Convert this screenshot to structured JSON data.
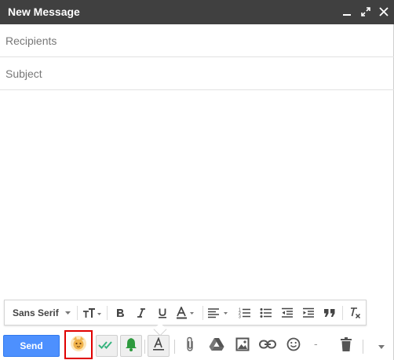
{
  "window": {
    "title": "New Message",
    "controls": [
      "minimize-icon",
      "expand-icon",
      "close-icon"
    ]
  },
  "fields": {
    "recipients_placeholder": "Recipients",
    "recipients_value": "",
    "subject_placeholder": "Subject",
    "subject_value": ""
  },
  "body": {
    "text": ""
  },
  "format_toolbar": {
    "font_family": "Sans Serif",
    "items": [
      "font-size-icon",
      "bold-icon",
      "italic-icon",
      "underline-icon",
      "text-color-icon",
      "align-icon",
      "numbered-list-icon",
      "bulleted-list-icon",
      "indent-less-icon",
      "indent-more-icon",
      "quote-icon",
      "remove-formatting-icon"
    ]
  },
  "action_bar": {
    "send_label": "Send",
    "dash_label": "-",
    "items": [
      "extension-avatar-icon",
      "double-check-icon",
      "bell-icon",
      "formatting-toggle-icon",
      "attach-icon",
      "drive-icon",
      "insert-photo-icon",
      "link-icon",
      "emoji-icon",
      "trash-icon",
      "more-options-icon"
    ]
  },
  "colors": {
    "titlebar": "#404040",
    "send_button": "#4d90fe",
    "highlight_border": "#e00000",
    "check_green": "#36b37e",
    "bell_green": "#2e9a3e"
  }
}
